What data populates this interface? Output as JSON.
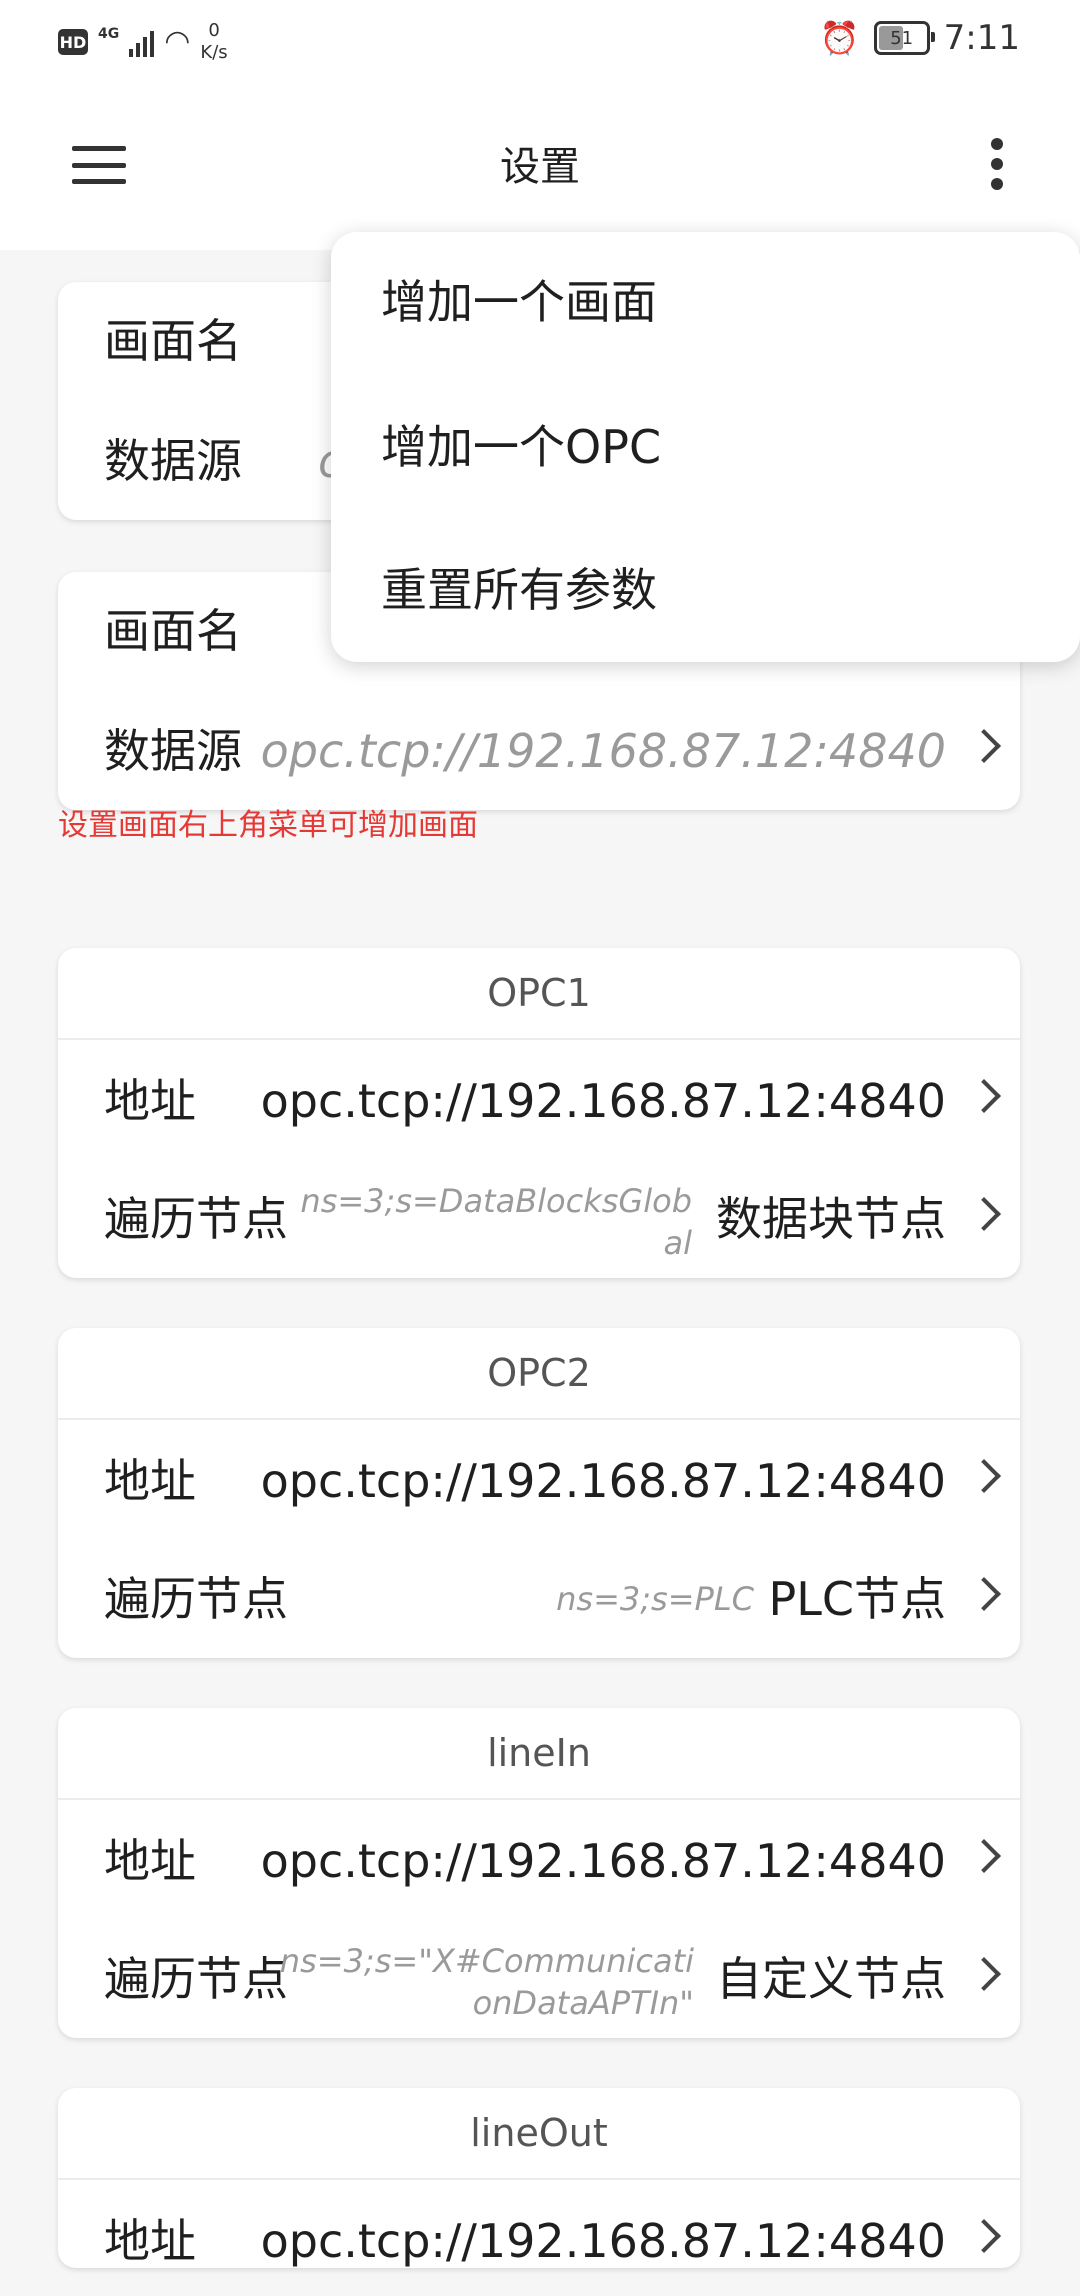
{
  "status_bar": {
    "hd": "HD",
    "network": "4G",
    "speed_value": "0",
    "speed_unit": "K/s",
    "battery": "51",
    "time": "7:11"
  },
  "header": {
    "title": "设置",
    "menu_icon": "hamburger-icon",
    "more_icon": "more-vert-icon"
  },
  "screens": [
    {
      "name_label": "画面名",
      "source_label": "数据源",
      "source_value": "o"
    },
    {
      "name_label": "画面名",
      "source_label": "数据源",
      "source_value": "opc.tcp://192.168.87.12:4840"
    }
  ],
  "hint": "设置画面右上角菜单可增加画面",
  "opc_cards": [
    {
      "title": "OPC1",
      "address_label": "地址",
      "address_value": "opc.tcp://192.168.87.12:4840",
      "node_label": "遍历节点",
      "node_id_line1": "ns=3;s=DataBlocksGlob",
      "node_id_line2": "al",
      "node_type": "数据块节点"
    },
    {
      "title": "OPC2",
      "address_label": "地址",
      "address_value": "opc.tcp://192.168.87.12:4840",
      "node_label": "遍历节点",
      "node_id_line1": "ns=3;s=PLC",
      "node_id_line2": "",
      "node_type": "PLC节点"
    },
    {
      "title": "lineIn",
      "address_label": "地址",
      "address_value": "opc.tcp://192.168.87.12:4840",
      "node_label": "遍历节点",
      "node_id_line1": "ns=3;s=\"X#Communicati",
      "node_id_line2": "onDataAPTIn\"",
      "node_type": "自定义节点"
    },
    {
      "title": "lineOut",
      "address_label": "地址",
      "address_value": "opc.tcp://192.168.87.12:4840"
    }
  ],
  "popup_menu": {
    "items": [
      "增加一个画面",
      "增加一个OPC",
      "重置所有参数"
    ]
  },
  "colors": {
    "hint_red": "#e53935",
    "muted_text": "#9a9a9a",
    "background": "#f6f6f6"
  }
}
